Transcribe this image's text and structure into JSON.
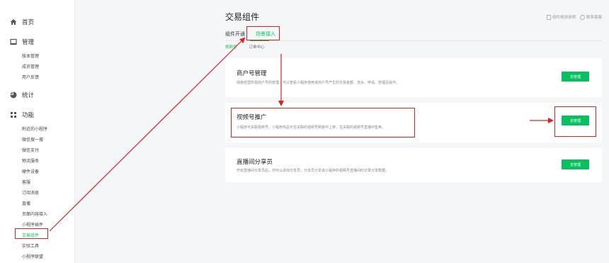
{
  "sidebar": {
    "groups": [
      {
        "label": "首页",
        "icon": "home-icon"
      },
      {
        "label": "管理",
        "icon": "manage-icon"
      },
      {
        "label": "统计",
        "icon": "stats-icon"
      },
      {
        "label": "功能",
        "icon": "function-icon"
      }
    ],
    "manage_items": [
      "版本管理",
      "成员管理",
      "用户反馈"
    ],
    "function_items": [
      "附近的小程序",
      "微信搜一搜",
      "微信支付",
      "物流服务",
      "硬件设备",
      "客服",
      "订阅消息",
      "直播",
      "页面内容接入",
      "小程序插件",
      "交易组件",
      "实验工具",
      "小程序联盟"
    ]
  },
  "header": {
    "title": "交易组件",
    "links": [
      "组件规则说明",
      "联系客服"
    ]
  },
  "tabs": [
    "组件开通",
    "场景接入"
  ],
  "subtabs": [
    "视频号",
    "订单中心"
  ],
  "cards": [
    {
      "title": "商户号管理",
      "desc": "场景经营所需商户号的管理，可以查看小程序使用该商户号产生的交易金额、流水、申请、管理及操作。",
      "button": "去管理"
    },
    {
      "title": "视频号推广",
      "desc": "小程序可关联视频号，小程序商品可在关联的视频号橱窗中上架，在关联的视频号直播中售卖。",
      "button": "去管理"
    },
    {
      "title": "直播间分享员",
      "desc": "开启直播间分享员后，你可以添加分享员，分享员分享该小程序的视频号直播间时记录分享数据。",
      "button": "去管理"
    }
  ],
  "colors": {
    "accent": "#07c160",
    "annotation": "#e02020"
  }
}
